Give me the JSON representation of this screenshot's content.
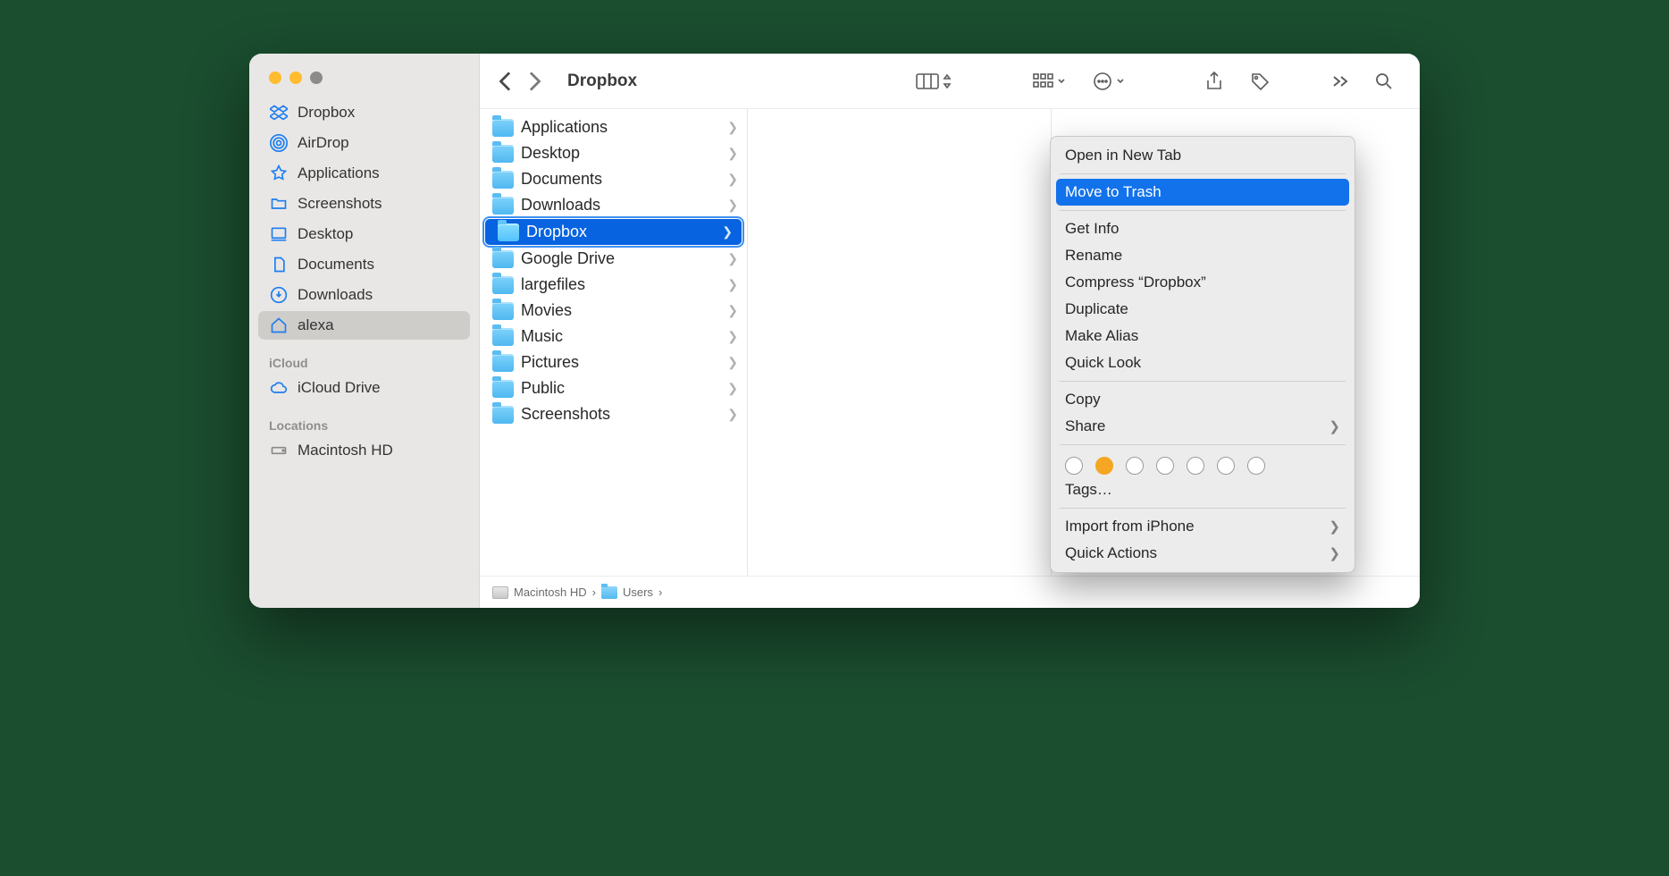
{
  "window": {
    "title": "Dropbox"
  },
  "sidebar": {
    "favorites": [
      {
        "label": "Dropbox",
        "icon": "dropbox-icon"
      },
      {
        "label": "AirDrop",
        "icon": "airdrop-icon"
      },
      {
        "label": "Applications",
        "icon": "applications-icon"
      },
      {
        "label": "Screenshots",
        "icon": "folder-icon"
      },
      {
        "label": "Desktop",
        "icon": "desktop-icon"
      },
      {
        "label": "Documents",
        "icon": "documents-icon"
      },
      {
        "label": "Downloads",
        "icon": "downloads-icon"
      },
      {
        "label": "alexa",
        "icon": "home-icon",
        "active": true
      }
    ],
    "sections": {
      "icloud_label": "iCloud",
      "icloud_items": [
        {
          "label": "iCloud Drive",
          "icon": "cloud-icon"
        }
      ],
      "locations_label": "Locations",
      "locations_items": [
        {
          "label": "Macintosh HD",
          "icon": "disk-icon"
        }
      ]
    }
  },
  "column_items": [
    {
      "label": "Applications"
    },
    {
      "label": "Desktop"
    },
    {
      "label": "Documents"
    },
    {
      "label": "Downloads"
    },
    {
      "label": "Dropbox",
      "selected": true
    },
    {
      "label": "Google Drive"
    },
    {
      "label": "largefiles"
    },
    {
      "label": "Movies"
    },
    {
      "label": "Music"
    },
    {
      "label": "Pictures"
    },
    {
      "label": "Public"
    },
    {
      "label": "Screenshots"
    }
  ],
  "pathbar": {
    "crumbs": [
      {
        "label": "Macintosh HD",
        "icon": "disk"
      },
      {
        "label": "Users",
        "icon": "folder"
      }
    ]
  },
  "context_menu": {
    "open_new_tab": "Open in New Tab",
    "move_to_trash": "Move to Trash",
    "get_info": "Get Info",
    "rename": "Rename",
    "compress": "Compress “Dropbox”",
    "duplicate": "Duplicate",
    "make_alias": "Make Alias",
    "quick_look": "Quick Look",
    "copy": "Copy",
    "share": "Share",
    "tags": "Tags…",
    "import_iphone": "Import from iPhone",
    "quick_actions": "Quick Actions"
  }
}
